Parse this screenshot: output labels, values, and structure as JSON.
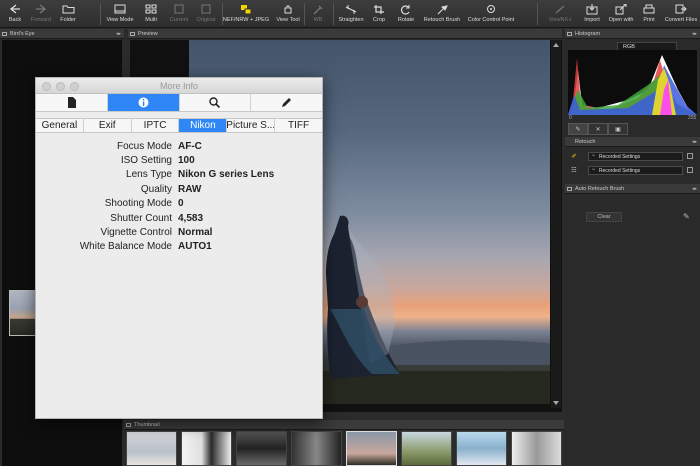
{
  "toolbar": {
    "back": "Back",
    "forward": "Forward",
    "folder": "Folder",
    "view_mode": "View Mode",
    "multi": "Multi",
    "current": "Current",
    "original": "Original",
    "nef_jpeg": "NEF/NRW + JPEG",
    "view_tool": "View Tool",
    "wb": "WB",
    "straighten": "Straighten",
    "crop": "Crop",
    "rotate": "Rotate",
    "retouch_brush": "Retouch Brush",
    "color_control_point": "Color Control Point",
    "viewnx": "ViewNX-i",
    "import": "Import",
    "open_with": "Open with",
    "print": "Print",
    "convert_files": "Convert Files"
  },
  "panels": {
    "birds_eye": "Bird's Eye",
    "preview": "Preview",
    "thumbnail": "Thumbnail",
    "histogram": "Histogram",
    "retouch": "Retouch",
    "auto_retouch_brush": "Auto Retouch Brush"
  },
  "histogram": {
    "channel": "RGB",
    "min": "0",
    "max": "255"
  },
  "retouch": {
    "row1": "Recorded Settings",
    "row2": "Recorded Settings",
    "clear": "Clear"
  },
  "dialog": {
    "title": "More Info",
    "tabs": [
      "General",
      "Exif",
      "IPTC",
      "Nikon",
      "Picture S...",
      "TIFF"
    ],
    "active_tab": "Nikon",
    "rows": [
      {
        "key": "Focus Mode",
        "value": "AF-C"
      },
      {
        "key": "ISO Setting",
        "value": "100"
      },
      {
        "key": "Lens Type",
        "value": "Nikon G series Lens"
      },
      {
        "key": "Quality",
        "value": "RAW"
      },
      {
        "key": "Shooting Mode",
        "value": "0"
      },
      {
        "key": "Shutter Count",
        "value": "4,583"
      },
      {
        "key": "Vignette Control",
        "value": "Normal"
      },
      {
        "key": "White Balance Mode",
        "value": "AUTO1"
      }
    ]
  },
  "colors": {
    "accent": "#2f86f6",
    "toolbar_bg": "#333333",
    "app_bg": "#2b2b2b"
  }
}
